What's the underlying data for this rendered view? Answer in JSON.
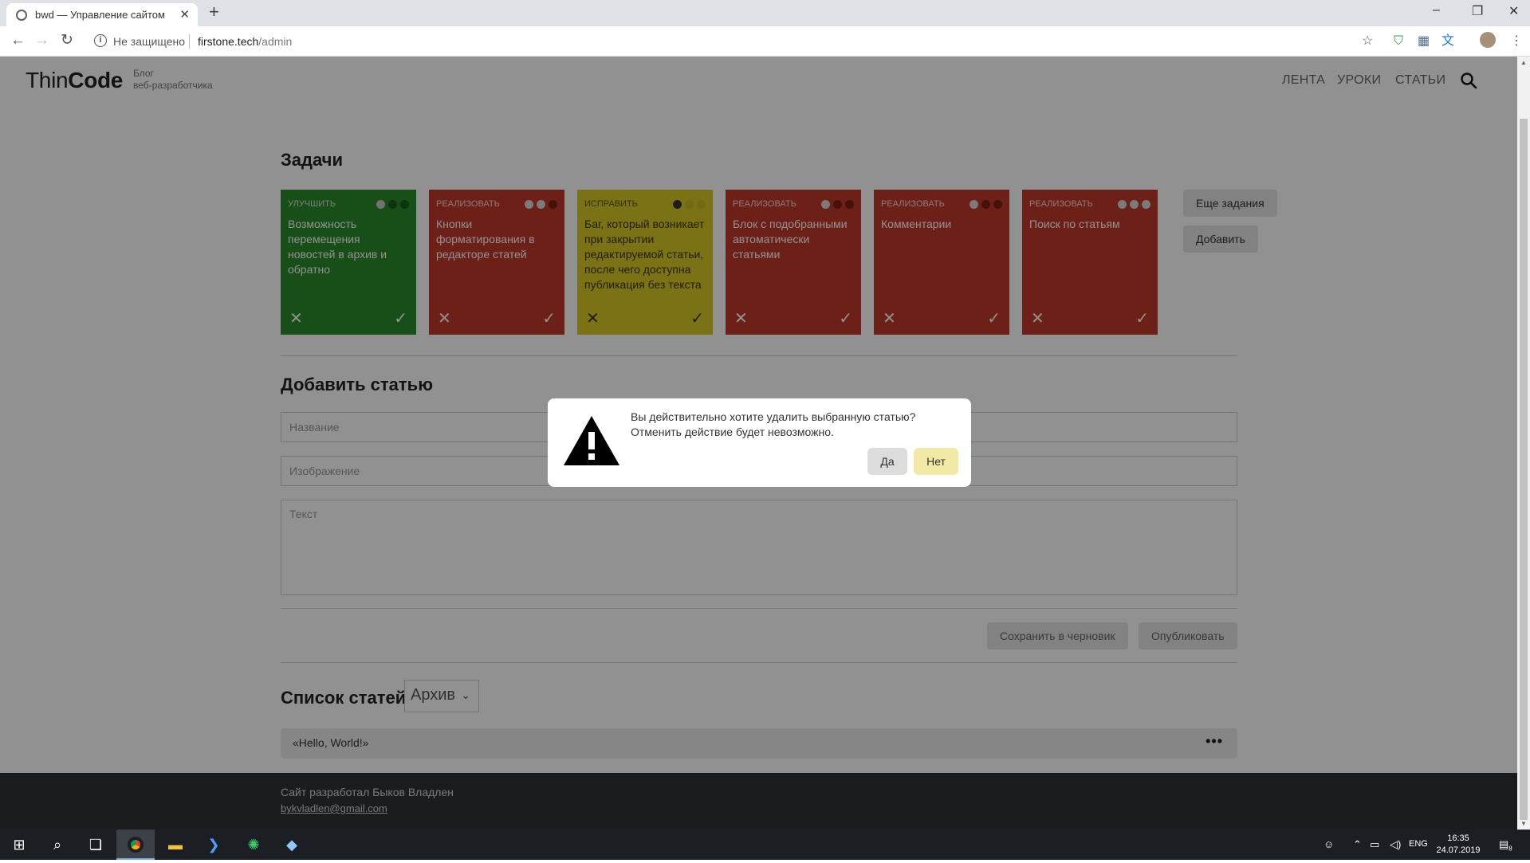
{
  "browser": {
    "tab_title": "bwd — Управление сайтом",
    "security_text": "Не защищено",
    "url_host": "firstone.tech",
    "url_path": "/admin"
  },
  "site": {
    "logo_thin": "Thin",
    "logo_code": "Code",
    "tagline_line1": "Блог",
    "tagline_line2": "веб-разработчика",
    "nav": [
      "ЛЕНТА",
      "УРОКИ",
      "СТАТЬИ"
    ]
  },
  "tasks": {
    "title": "Задачи",
    "items": [
      {
        "type": "Улучшить",
        "text": "Возможность перемещения новостей в архив и обратно",
        "color": "#2b8a2b",
        "dots": [
          "#c8c8c8",
          "#1a5c1a",
          "#1a5c1a"
        ]
      },
      {
        "type": "Реализовать",
        "text": "Кнопки форматирования в редакторе статей",
        "color": "#c0392b",
        "dots": [
          "#d9d9d9",
          "#d9d9d9",
          "#7a1f15"
        ]
      },
      {
        "type": "Исправить",
        "text": "Баг, который возникает при закрытии редактируемой статьи, после чего доступна публикация без текста",
        "color": "#d7c826",
        "dots": [
          "#333333",
          "#c9bb20",
          "#c9bb20"
        ]
      },
      {
        "type": "Реализовать",
        "text": "Блок с подобранными автоматически статьями",
        "color": "#c0392b",
        "dots": [
          "#d9d9d9",
          "#7a1f15",
          "#7a1f15"
        ]
      },
      {
        "type": "Реализовать",
        "text": "Комментарии",
        "color": "#c0392b",
        "dots": [
          "#d9d9d9",
          "#7a1f15",
          "#7a1f15"
        ]
      },
      {
        "type": "Реализовать",
        "text": "Поиск по статьям",
        "color": "#c0392b",
        "dots": [
          "#d9d9d9",
          "#d9d9d9",
          "#d9d9d9"
        ]
      }
    ],
    "more_label": "Еще задания",
    "add_label": "Добавить"
  },
  "add_article": {
    "title": "Добавить статью",
    "name_placeholder": "Название",
    "image_placeholder": "Изображение",
    "text_placeholder": "Текст",
    "draft_label": "Сохранить в черновик",
    "publish_label": "Опубликовать"
  },
  "article_list": {
    "title": "Список статей",
    "filter_value": "Архив",
    "articles": [
      "«Hello, World!»"
    ]
  },
  "footer": {
    "credit": "Сайт разработал Быков Владлен",
    "email": "bykvladlen@gmail.com"
  },
  "modal": {
    "message": "Вы действительно хотите удалить выбранную статью? Отменить действие будет невозможно.",
    "yes_label": "Да",
    "no_label": "Нет"
  },
  "taskbar": {
    "language": "ENG",
    "time": "16:35",
    "date": "24.07.2019",
    "notification_count": "8"
  },
  "colors": {
    "overlay": "rgba(0,0,0,0.43)",
    "footer": "#2e3338",
    "modal_yes": "#dcdcdc",
    "modal_no": "#f1e9a5"
  }
}
